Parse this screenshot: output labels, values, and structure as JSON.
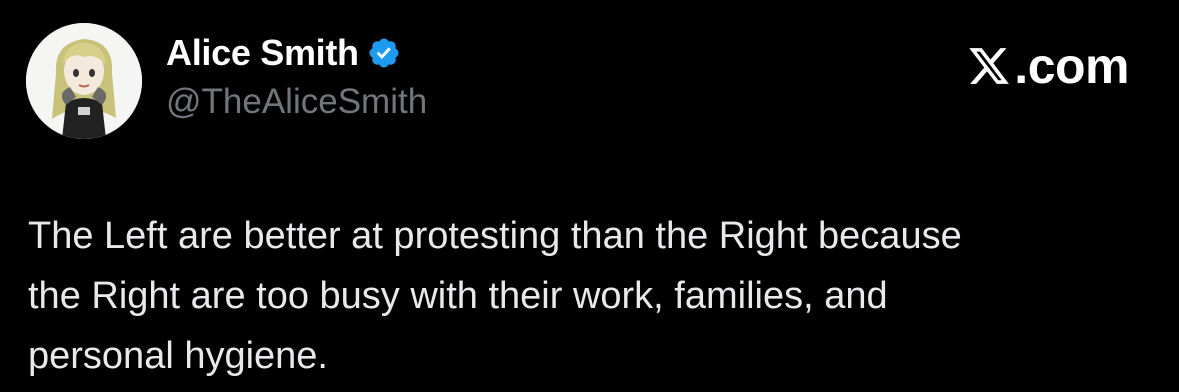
{
  "author": {
    "display_name": "Alice Smith",
    "handle": "@TheAliceSmith",
    "verified": true,
    "avatar_icon": "cartoon-alice-avatar"
  },
  "brand": {
    "text": ".com",
    "icon": "x-logo-icon"
  },
  "tweet": {
    "text": "The Left are better at protesting than the Right because\nthe Right are too busy with their work, families, and\npersonal hygiene."
  },
  "colors": {
    "background": "#000000",
    "name": "#ffffff",
    "handle": "#71767b",
    "body_text": "#e7e9ea",
    "verified_badge": "#1d9bf0"
  }
}
